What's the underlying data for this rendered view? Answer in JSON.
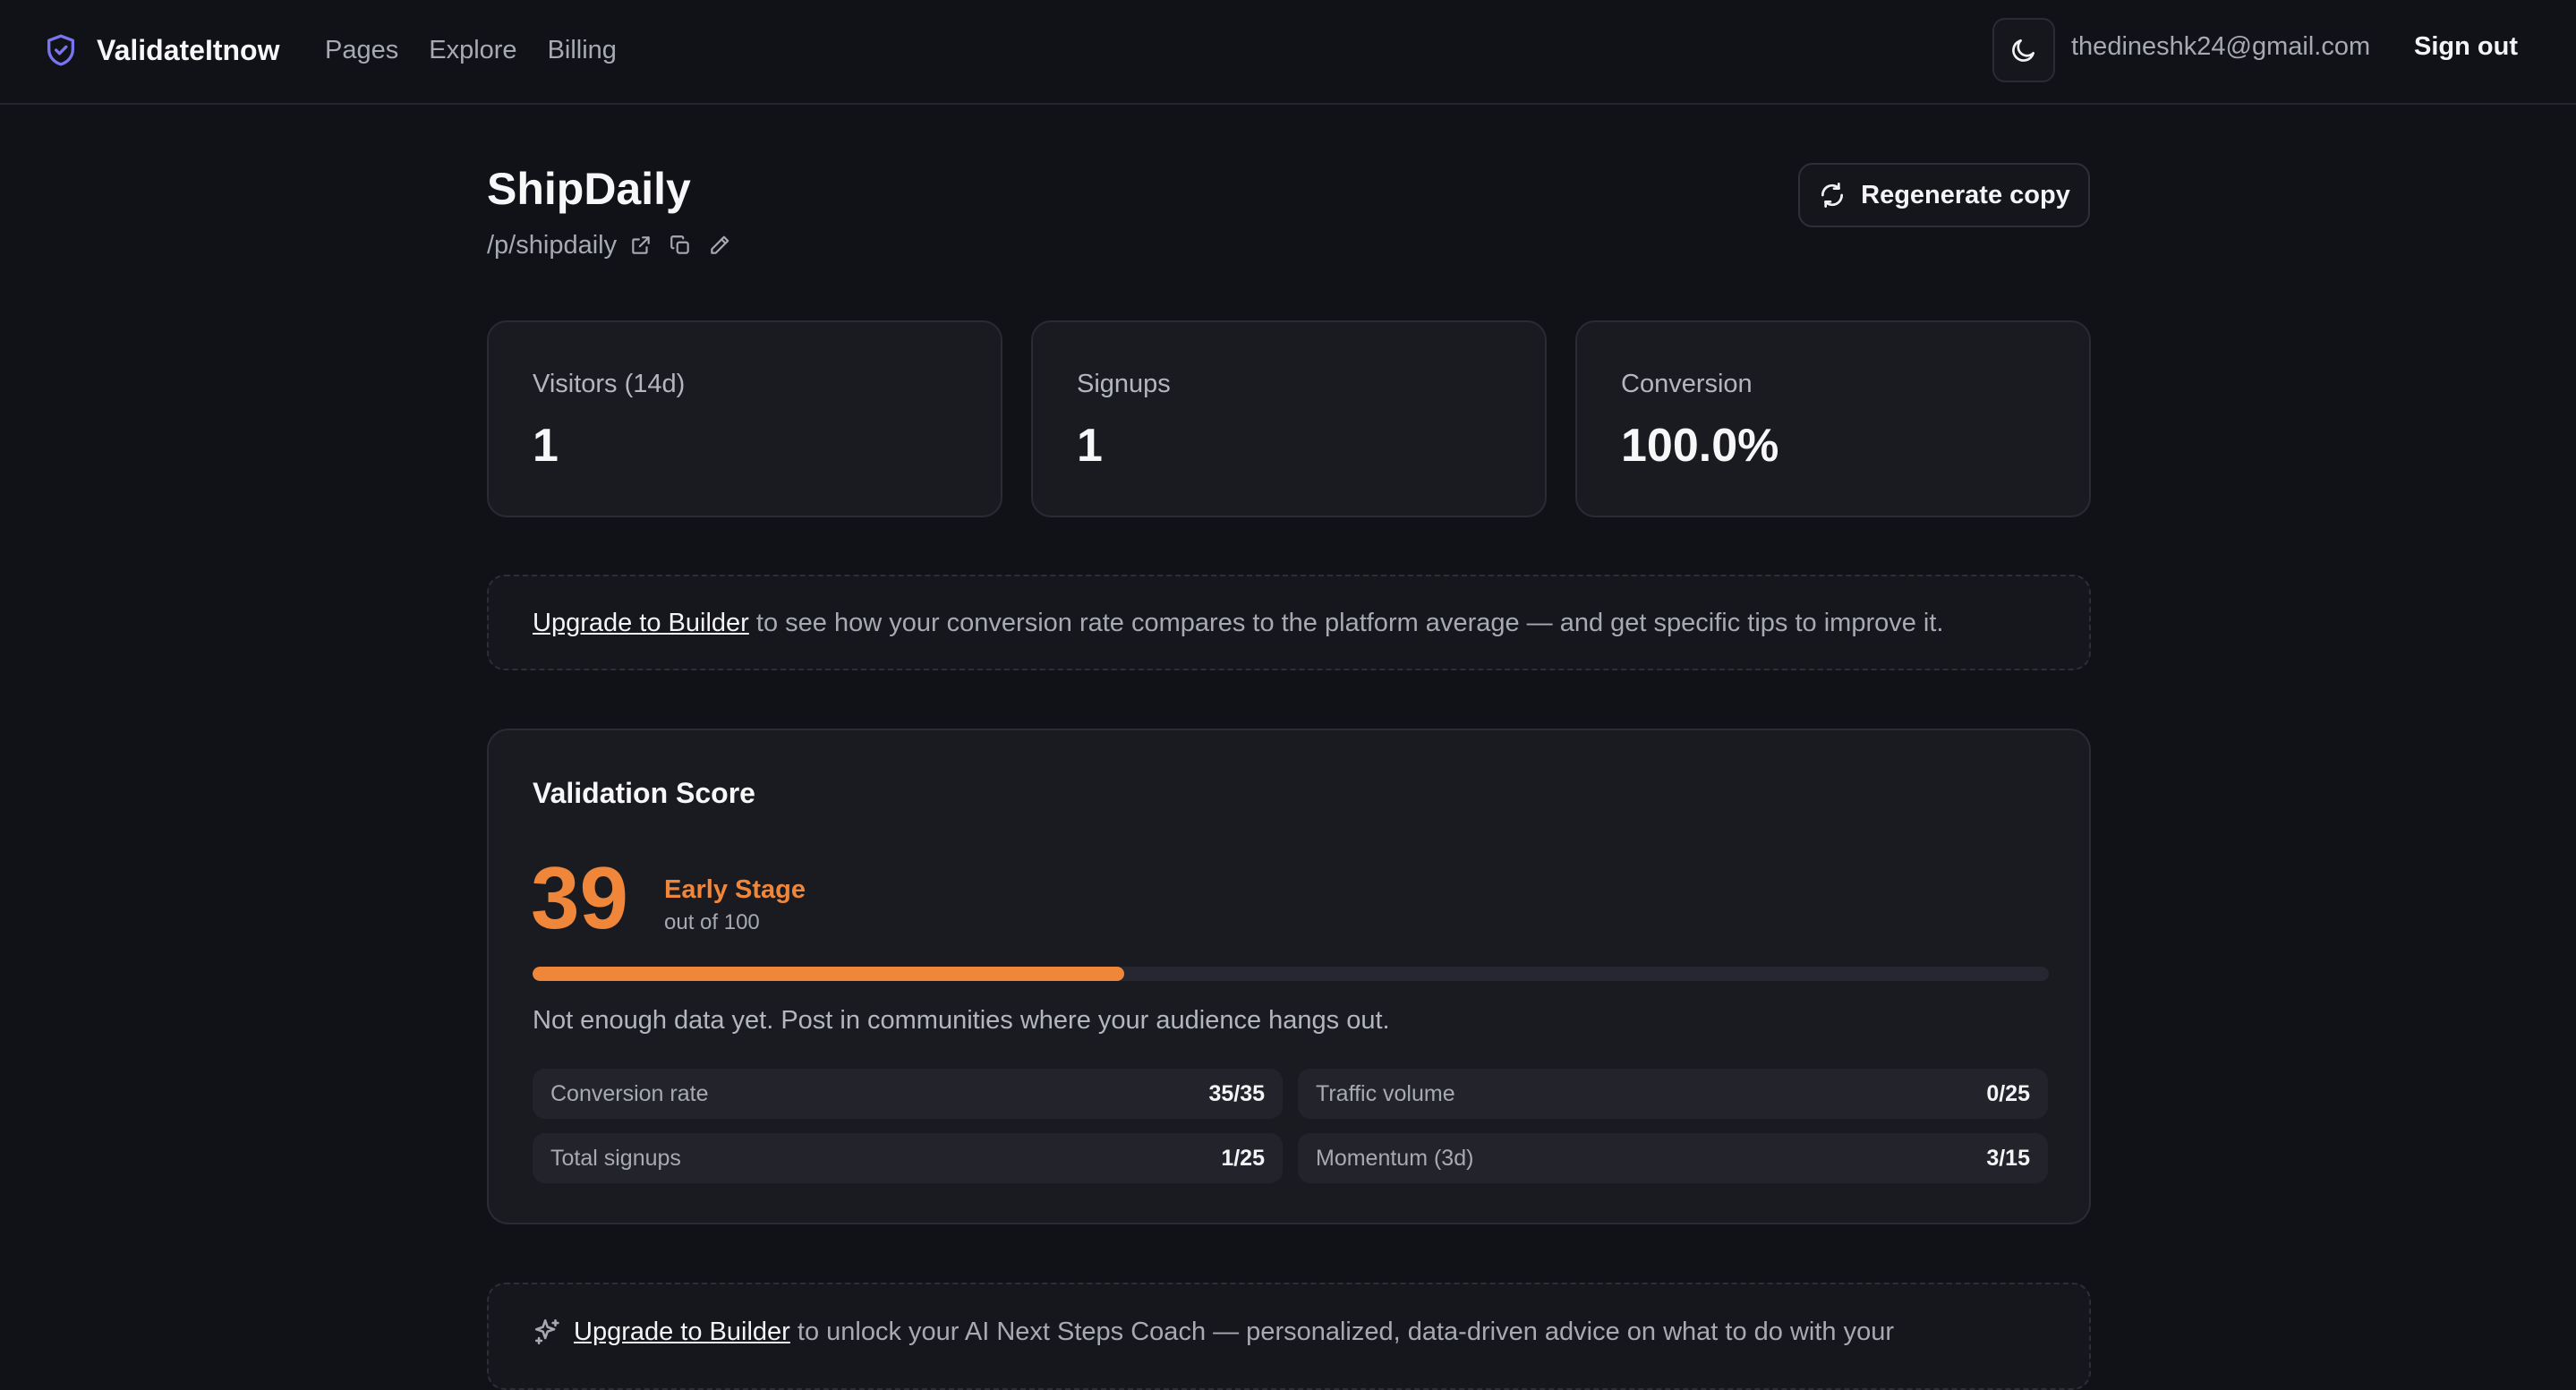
{
  "nav": {
    "brand": "ValidateItnow",
    "links": [
      "Pages",
      "Explore",
      "Billing"
    ],
    "email": "thedineshk24@gmail.com",
    "signout": "Sign out",
    "theme_icon": "moon-icon"
  },
  "page": {
    "title": "ShipDaily",
    "slug": "/p/shipdaily",
    "regenerate_label": "Regenerate copy"
  },
  "stats": [
    {
      "label": "Visitors (14d)",
      "value": "1"
    },
    {
      "label": "Signups",
      "value": "1"
    },
    {
      "label": "Conversion",
      "value": "100.0%"
    }
  ],
  "upgrade_banner": {
    "link": "Upgrade to Builder",
    "text": " to see how your conversion rate compares to the platform average — and get specific tips to improve it."
  },
  "validation": {
    "title": "Validation Score",
    "score": "39",
    "stage": "Early Stage",
    "out_of": "out of 100",
    "progress_fraction": 0.39,
    "message": "Not enough data yet. Post in communities where your audience hangs out.",
    "metrics": [
      {
        "label": "Conversion rate",
        "value": "35/35"
      },
      {
        "label": "Traffic volume",
        "value": "0/25"
      },
      {
        "label": "Total signups",
        "value": "1/25"
      },
      {
        "label": "Momentum (3d)",
        "value": "3/15"
      }
    ]
  },
  "coach_banner": {
    "link": "Upgrade to Builder",
    "text": " to unlock your AI Next Steps Coach — personalized, data-driven advice on what to do with your"
  },
  "colors": {
    "accent": "#f0863a",
    "brand_icon": "#7b74f0",
    "background": "#111217",
    "card": "#1a1b21"
  }
}
